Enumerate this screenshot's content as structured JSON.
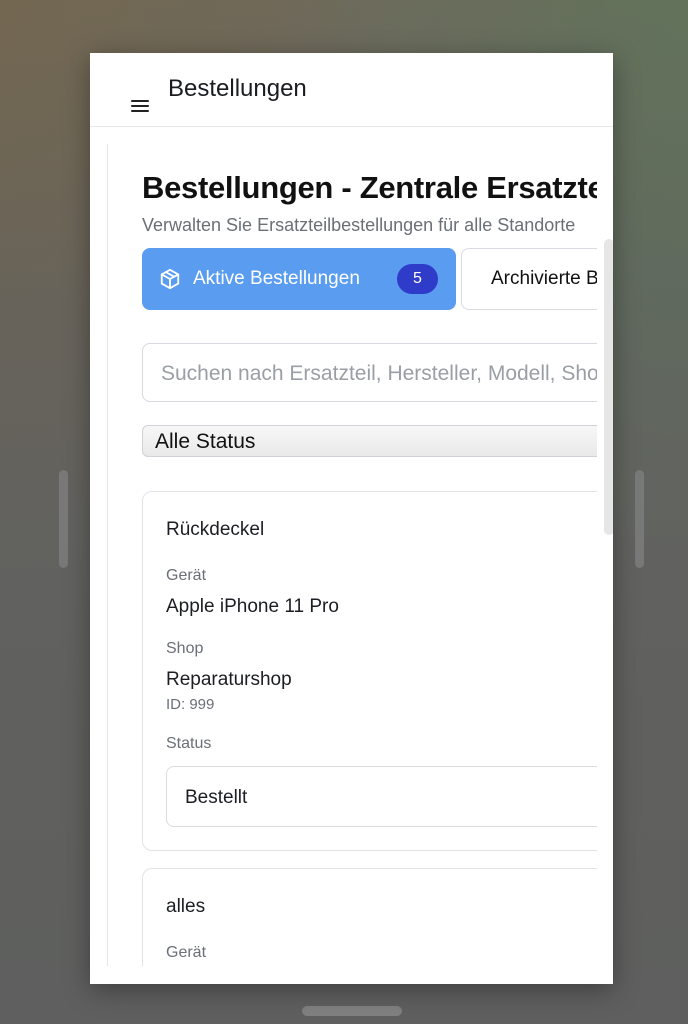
{
  "header": {
    "title": "Bestellungen"
  },
  "page": {
    "title": "Bestellungen - Zentrale Ersatzteilbestellungen",
    "subtitle": "Verwalten Sie Ersatzteilbestellungen für alle Standorte"
  },
  "tabs": {
    "active": {
      "label": "Aktive Bestellungen",
      "badge": "5"
    },
    "archive": {
      "label": "Archivierte Bestellungen"
    }
  },
  "search": {
    "placeholder": "Suchen nach Ersatzteil, Hersteller, Modell, Shop..."
  },
  "status_filter": {
    "selected": "Alle Status"
  },
  "orders": [
    {
      "title": "Rückdeckel",
      "device_label": "Gerät",
      "device": "Apple iPhone 11 Pro",
      "shop_label": "Shop",
      "shop": "Reparaturshop",
      "shop_id": "ID: 999",
      "status_label": "Status",
      "status": "Bestellt"
    },
    {
      "title": "alles",
      "device_label": "Gerät"
    }
  ],
  "colors": {
    "primary": "#5a9cf0",
    "badge": "#2f3bc9"
  },
  "icons": {
    "menu": "hamburger-menu-icon",
    "active_tab": "box-icon",
    "archive_tab": "check-circle-icon"
  }
}
